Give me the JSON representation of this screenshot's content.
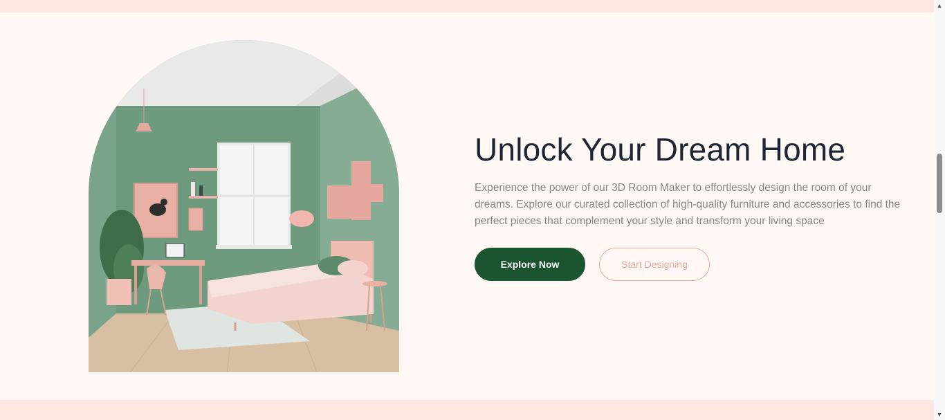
{
  "hero": {
    "title": "Unlock Your Dream Home",
    "description": "Experience the power of our 3D Room Maker to effortlessly design the room of your dreams. Explore our curated collection of high-quality furniture and accessories to find the perfect pieces that complement your style and transform your living space",
    "primary_button": "Explore Now",
    "secondary_button": "Start Designing"
  },
  "colors": {
    "background": "#fff8f5",
    "band": "#ffe6e0",
    "primary": "#1a5530",
    "accent": "#f0a8a0",
    "title": "#1d2733",
    "body_text": "#8a8583"
  },
  "scrollbar": {
    "up_icon": "triangle-up-icon",
    "down_icon": "triangle-down-icon"
  }
}
